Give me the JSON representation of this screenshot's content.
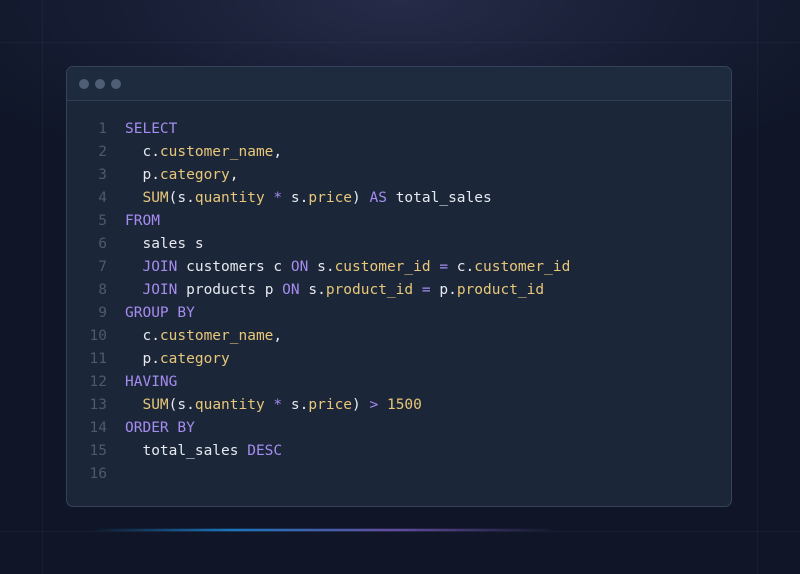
{
  "window": {
    "controls": [
      "window-dot",
      "window-dot",
      "window-dot"
    ]
  },
  "colors": {
    "keyword": "#a58cf0",
    "identifier": "#e8c77a",
    "plain": "#e6e9ef",
    "line_number": "#4c5a70",
    "panel": "#1b2638"
  },
  "code": {
    "language": "SQL",
    "lines": [
      {
        "n": "1",
        "tokens": [
          {
            "t": "SELECT",
            "c": "k"
          }
        ]
      },
      {
        "n": "2",
        "tokens": [
          {
            "t": "  c.",
            "c": "w"
          },
          {
            "t": "customer_name",
            "c": "y"
          },
          {
            "t": ",",
            "c": "w"
          }
        ]
      },
      {
        "n": "3",
        "tokens": [
          {
            "t": "  p.",
            "c": "w"
          },
          {
            "t": "category",
            "c": "y"
          },
          {
            "t": ",",
            "c": "w"
          }
        ]
      },
      {
        "n": "4",
        "tokens": [
          {
            "t": "  SUM",
            "c": "y"
          },
          {
            "t": "(s.",
            "c": "w"
          },
          {
            "t": "quantity",
            "c": "y"
          },
          {
            "t": " * ",
            "c": "k"
          },
          {
            "t": "s.",
            "c": "w"
          },
          {
            "t": "price",
            "c": "y"
          },
          {
            "t": ") ",
            "c": "w"
          },
          {
            "t": "AS",
            "c": "k"
          },
          {
            "t": " total_sales",
            "c": "w"
          }
        ]
      },
      {
        "n": "5",
        "tokens": [
          {
            "t": "FROM",
            "c": "k"
          }
        ]
      },
      {
        "n": "6",
        "tokens": [
          {
            "t": "  sales s",
            "c": "w"
          }
        ]
      },
      {
        "n": "7",
        "tokens": [
          {
            "t": "  JOIN",
            "c": "k"
          },
          {
            "t": " customers c ",
            "c": "w"
          },
          {
            "t": "ON",
            "c": "k"
          },
          {
            "t": " s.",
            "c": "w"
          },
          {
            "t": "customer_id",
            "c": "y"
          },
          {
            "t": " = ",
            "c": "k"
          },
          {
            "t": "c.",
            "c": "w"
          },
          {
            "t": "customer_id",
            "c": "y"
          }
        ]
      },
      {
        "n": "8",
        "tokens": [
          {
            "t": "  JOIN",
            "c": "k"
          },
          {
            "t": " products p ",
            "c": "w"
          },
          {
            "t": "ON",
            "c": "k"
          },
          {
            "t": " s.",
            "c": "w"
          },
          {
            "t": "product_id",
            "c": "y"
          },
          {
            "t": " = ",
            "c": "k"
          },
          {
            "t": "p.",
            "c": "w"
          },
          {
            "t": "product_id",
            "c": "y"
          }
        ]
      },
      {
        "n": "9",
        "tokens": [
          {
            "t": "GROUP BY",
            "c": "k"
          }
        ]
      },
      {
        "n": "10",
        "tokens": [
          {
            "t": "  c.",
            "c": "w"
          },
          {
            "t": "customer_name",
            "c": "y"
          },
          {
            "t": ",",
            "c": "w"
          }
        ]
      },
      {
        "n": "11",
        "tokens": [
          {
            "t": "  p.",
            "c": "w"
          },
          {
            "t": "category",
            "c": "y"
          }
        ]
      },
      {
        "n": "12",
        "tokens": [
          {
            "t": "HAVING",
            "c": "k"
          }
        ]
      },
      {
        "n": "13",
        "tokens": [
          {
            "t": "  SUM",
            "c": "y"
          },
          {
            "t": "(s.",
            "c": "w"
          },
          {
            "t": "quantity",
            "c": "y"
          },
          {
            "t": " * ",
            "c": "k"
          },
          {
            "t": "s.",
            "c": "w"
          },
          {
            "t": "price",
            "c": "y"
          },
          {
            "t": ") ",
            "c": "w"
          },
          {
            "t": ">",
            "c": "k"
          },
          {
            "t": " 1500",
            "c": "y"
          }
        ]
      },
      {
        "n": "14",
        "tokens": [
          {
            "t": "ORDER BY",
            "c": "k"
          }
        ]
      },
      {
        "n": "15",
        "tokens": [
          {
            "t": "  total_sales ",
            "c": "w"
          },
          {
            "t": "DESC",
            "c": "k"
          }
        ]
      },
      {
        "n": "16",
        "tokens": []
      }
    ]
  }
}
